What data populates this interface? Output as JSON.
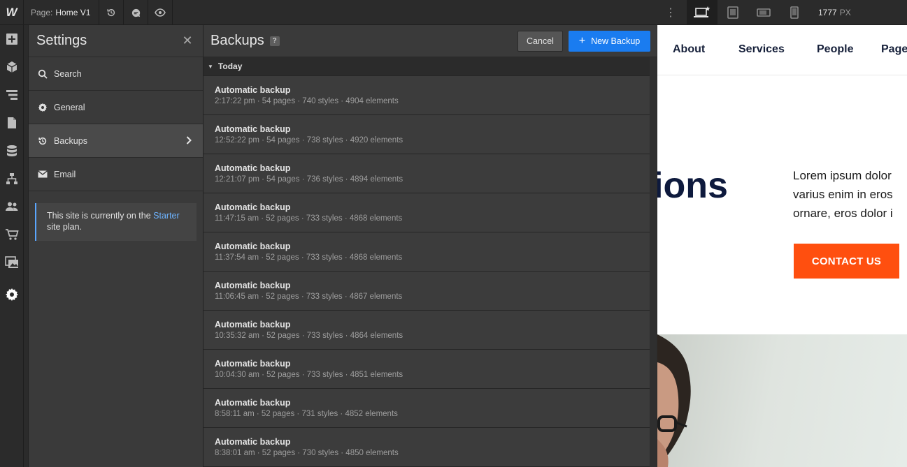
{
  "topbar": {
    "logo": "W",
    "page_label": "Page:",
    "page_name": "Home V1",
    "width_value": "1777",
    "width_unit": "PX"
  },
  "settings": {
    "title": "Settings",
    "items": [
      {
        "label": "Search",
        "icon": "search-icon"
      },
      {
        "label": "General",
        "icon": "gear-icon"
      },
      {
        "label": "Backups",
        "icon": "history-icon"
      },
      {
        "label": "Email",
        "icon": "envelope-icon"
      }
    ],
    "plan_note": {
      "prefix": "This site is currently on the ",
      "plan": "Starter",
      "suffix": " site plan."
    }
  },
  "backups": {
    "title": "Backups",
    "help": "?",
    "cancel_label": "Cancel",
    "new_label": "New Backup",
    "group_label": "Today",
    "rows": [
      {
        "title": "Automatic backup",
        "meta": "2:17:22 pm · 54 pages · 740 styles · 4904 elements"
      },
      {
        "title": "Automatic backup",
        "meta": "12:52:22 pm · 54 pages · 738 styles · 4920 elements"
      },
      {
        "title": "Automatic backup",
        "meta": "12:21:07 pm · 54 pages · 736 styles · 4894 elements"
      },
      {
        "title": "Automatic backup",
        "meta": "11:47:15 am · 52 pages · 733 styles · 4868 elements"
      },
      {
        "title": "Automatic backup",
        "meta": "11:37:54 am · 52 pages · 733 styles · 4868 elements"
      },
      {
        "title": "Automatic backup",
        "meta": "11:06:45 am · 52 pages · 733 styles · 4867 elements"
      },
      {
        "title": "Automatic backup",
        "meta": "10:35:32 am · 52 pages · 733 styles · 4864 elements"
      },
      {
        "title": "Automatic backup",
        "meta": "10:04:30 am · 52 pages · 733 styles · 4851 elements"
      },
      {
        "title": "Automatic backup",
        "meta": "8:58:11 am · 52 pages · 731 styles · 4852 elements"
      },
      {
        "title": "Automatic backup",
        "meta": "8:38:01 am · 52 pages · 730 styles · 4850 elements"
      }
    ]
  },
  "preview": {
    "nav": [
      "About",
      "Services",
      "People",
      "Page"
    ],
    "hero_fragment": "ions",
    "hero_copy": [
      "Lorem ipsum dolor",
      "varius enim in eros",
      "ornare, eros dolor i"
    ],
    "cta_label": "CONTACT US"
  },
  "colors": {
    "accent_blue": "#1a7cf0",
    "cta_orange": "#ff4f0f",
    "link_blue": "#6eb4ff"
  }
}
